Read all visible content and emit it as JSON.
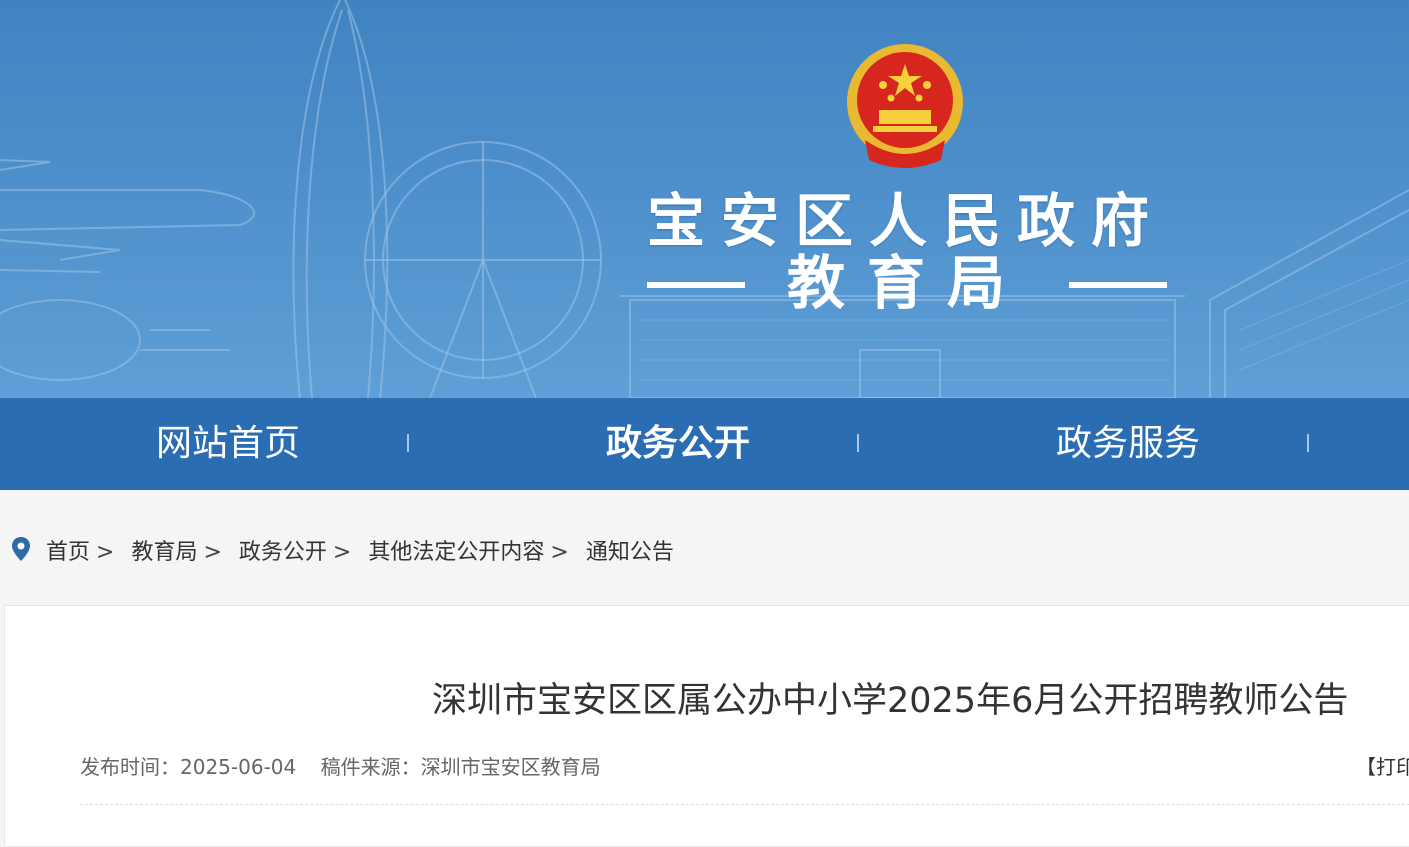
{
  "header": {
    "org_name": "宝安区人民政府",
    "dept_name": "教育局"
  },
  "nav": {
    "items": [
      {
        "label": "网站首页",
        "active": false
      },
      {
        "label": "政务公开",
        "active": true
      },
      {
        "label": "政务服务",
        "active": false
      }
    ]
  },
  "breadcrumb": {
    "icon": "location-pin-icon",
    "items": [
      "首页",
      "教育局",
      "政务公开",
      "其他法定公开内容",
      "通知公告"
    ],
    "separator": ">"
  },
  "article": {
    "title": "深圳市宝安区区属公办中小学2025年6月公开招聘教师公告",
    "publish_label": "发布时间：",
    "publish_date": "2025-06-04",
    "source_label": "稿件来源：",
    "source": "深圳市宝安区教育局",
    "print_label": "【打印"
  },
  "colors": {
    "banner": "#4d8fcb",
    "nav": "#2b6db3",
    "page_bg": "#f5f5f5"
  }
}
